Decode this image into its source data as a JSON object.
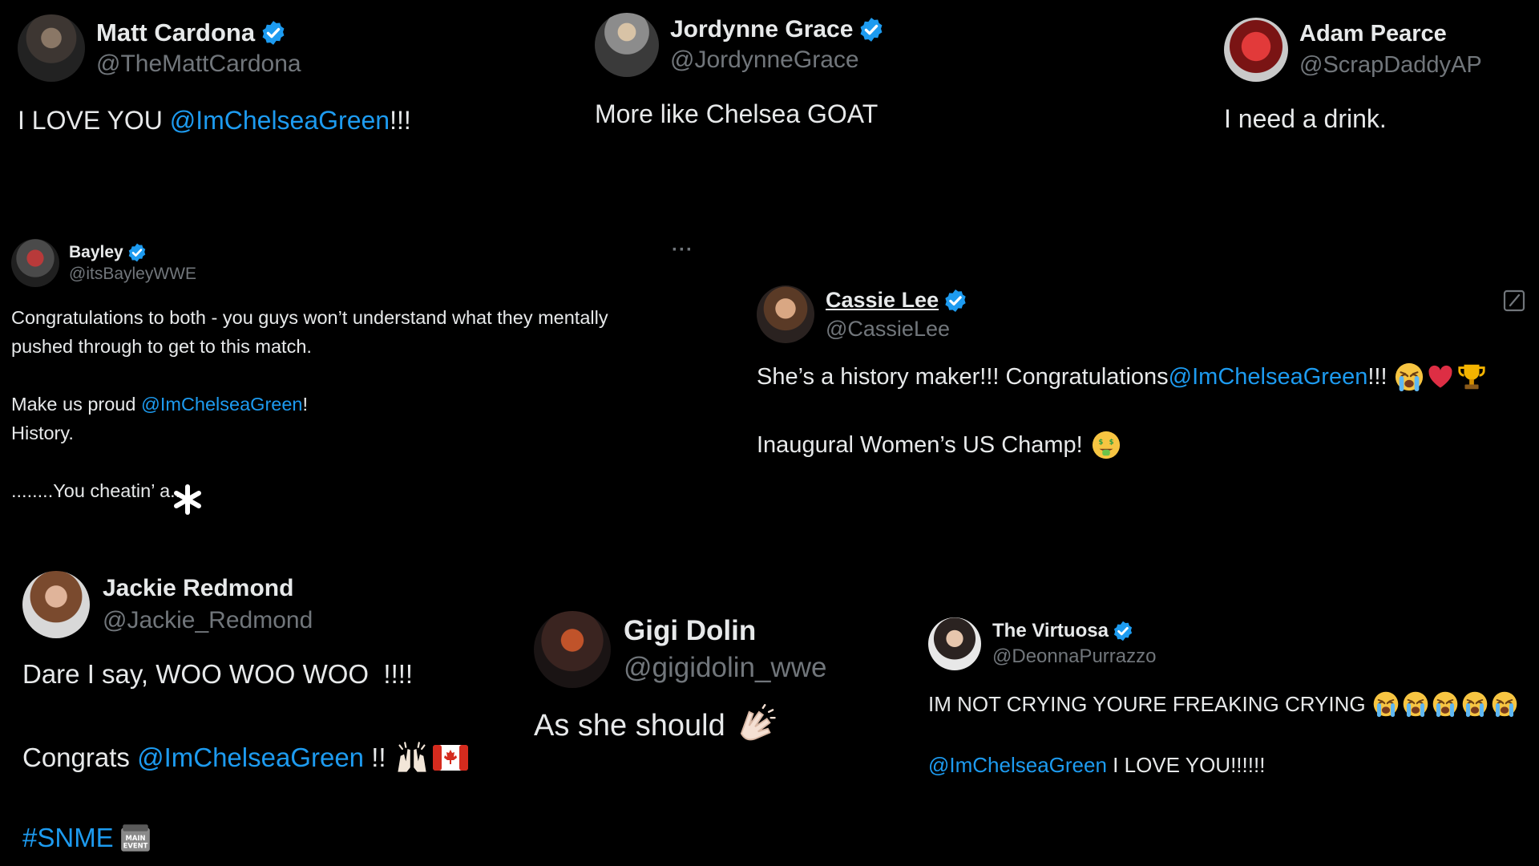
{
  "colors": {
    "bg": "#000000",
    "text": "#e7e9ea",
    "handle": "#71767b",
    "mention": "#1d9bf0",
    "verified": "#1d9bf0"
  },
  "tweets": {
    "cardona": {
      "name": "Matt Cardona",
      "handle": "@TheMattCardona",
      "t1": "I LOVE YOU ",
      "mention": "@ImChelseaGreen",
      "t2": "!!!"
    },
    "grace": {
      "name": "Jordynne Grace",
      "handle": "@JordynneGrace",
      "text": "More like Chelsea GOAT"
    },
    "pearce": {
      "name": "Adam Pearce",
      "handle": "@ScrapDaddyAP",
      "text": "I need a drink."
    },
    "bayley": {
      "name": "Bayley",
      "handle": "@itsBayleyWWE",
      "more": "···",
      "l1": "Congratulations to both - you guys won’t understand what they mentally",
      "l2": "pushed through to get to this match.",
      "l3a": "Make us proud ",
      "mention": "@ImChelseaGreen",
      "l3b": "!",
      "l4": "History.",
      "l5a": "........You cheatin’ ",
      "l5b": "a",
      "l5c": "...."
    },
    "cassie": {
      "name": "Cassie Lee",
      "handle": "@CassieLee",
      "l1a": "She’s a history maker!!! Congratulations ",
      "mention": "@ImChelseaGreen",
      "l1b": "!!!",
      "l2": "Inaugural Women’s US Champ!",
      "icons": [
        "crying-face-icon",
        "red-heart-icon",
        "trophy-icon",
        "money-mouth-face-icon",
        "compose-icon"
      ]
    },
    "jackie": {
      "name": "Jackie Redmond",
      "handle": "@Jackie_Redmond",
      "l1": "Dare I say, WOO WOO WOO  !!!!",
      "l2a": "Congrats ",
      "mention": "@ImChelseaGreen",
      "l2b": " !!",
      "hashtag": "#SNME",
      "icons": [
        "raising-hands-icon",
        "canada-flag-icon",
        "main-event-badge-icon"
      ]
    },
    "gigi": {
      "name": "Gigi Dolin",
      "handle": "@gigidolin_wwe",
      "text": "As she should",
      "icons": [
        "clapping-hands-icon"
      ]
    },
    "virtuosa": {
      "name": "The Virtuosa",
      "handle": "@DeonnaPurrazzo",
      "l1": "IM NOT CRYING YOURE FREAKING CRYING",
      "mention": "@ImChelseaGreen",
      "l2": " I LOVE YOU!!!!!!",
      "icons": [
        "crying-face-icon"
      ]
    }
  }
}
